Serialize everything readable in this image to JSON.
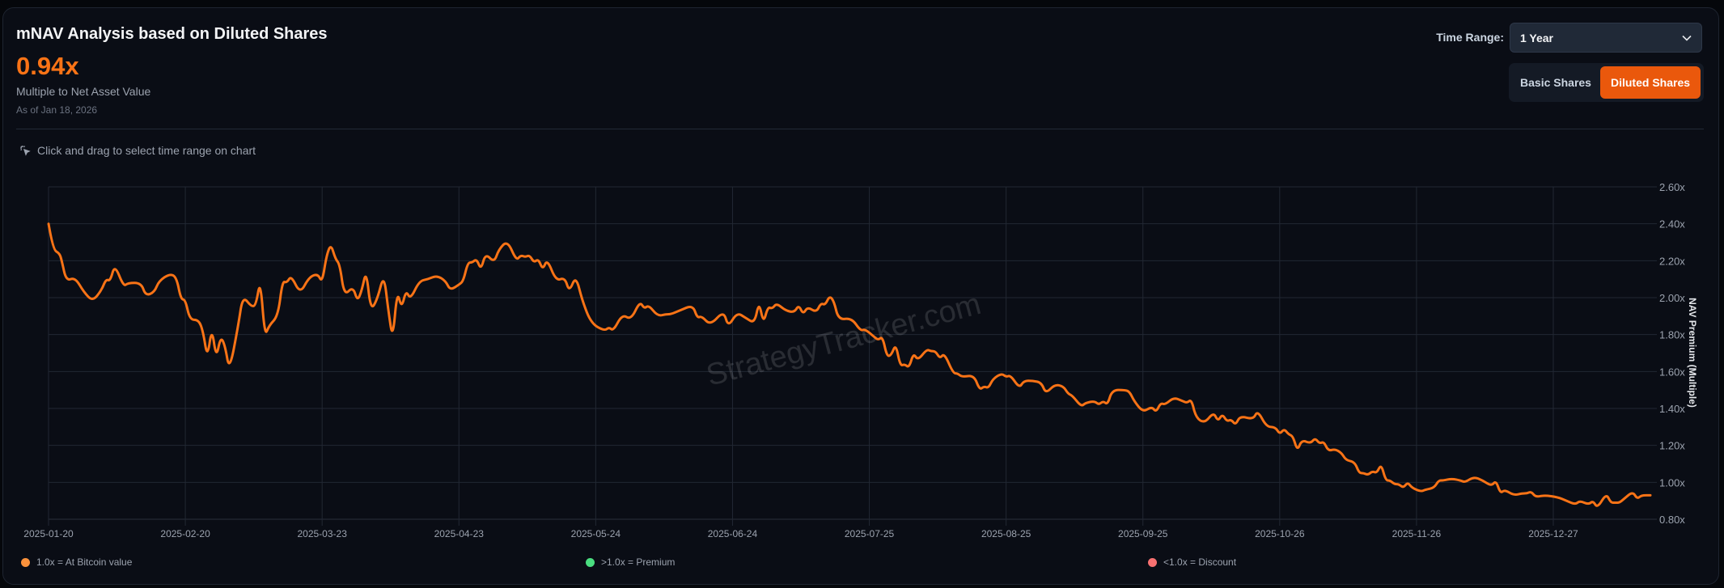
{
  "header": {
    "title": "mNAV Analysis based on Diluted Shares",
    "value": "0.94x",
    "subtitle": "Multiple to Net Asset Value",
    "as_of": "As of Jan 18, 2026",
    "hint": "Click and drag to select time range on chart"
  },
  "controls": {
    "time_range_label": "Time Range:",
    "time_range_value": "1 Year",
    "basic_label": "Basic Shares",
    "diluted_label": "Diluted Shares",
    "active": "Diluted Shares"
  },
  "colors": {
    "accent": "#ea580c",
    "line": "#f97316",
    "at_value": "#fb923c",
    "premium": "#4ade80",
    "discount": "#f87171"
  },
  "legend": [
    {
      "label": "1.0x = At Bitcoin value",
      "color": "#fb923c"
    },
    {
      "label": ">1.0x = Premium",
      "color": "#4ade80"
    },
    {
      "label": "<1.0x = Discount",
      "color": "#f87171"
    }
  ],
  "watermark": "StrategyTracker.com",
  "chart_data": {
    "type": "line",
    "title": "mNAV Analysis based on Diluted Shares",
    "ylabel": "NAV Premium (Multiple)",
    "xlabel": "",
    "x_start": "2025-01-20",
    "x_units": "days since 2025-01-20",
    "xlim": [
      0,
      363
    ],
    "ylim": [
      0.8,
      2.6
    ],
    "y_ticks": [
      "0.80x",
      "1.00x",
      "1.20x",
      "1.40x",
      "1.60x",
      "1.80x",
      "2.00x",
      "2.20x",
      "2.40x",
      "2.60x"
    ],
    "x_ticks": [
      {
        "day": 0,
        "label": "2025-01-20"
      },
      {
        "day": 31,
        "label": "2025-02-20"
      },
      {
        "day": 62,
        "label": "2025-03-23"
      },
      {
        "day": 93,
        "label": "2025-04-23"
      },
      {
        "day": 124,
        "label": "2025-05-24"
      },
      {
        "day": 155,
        "label": "2025-06-24"
      },
      {
        "day": 186,
        "label": "2025-07-25"
      },
      {
        "day": 217,
        "label": "2025-08-25"
      },
      {
        "day": 248,
        "label": "2025-09-25"
      },
      {
        "day": 279,
        "label": "2025-10-26"
      },
      {
        "day": 310,
        "label": "2025-11-26"
      },
      {
        "day": 341,
        "label": "2025-12-27"
      }
    ],
    "grid": true,
    "series": [
      {
        "name": "mNAV",
        "points": [
          [
            0,
            2.4
          ],
          [
            1,
            2.26
          ],
          [
            2.5,
            2.24
          ],
          [
            3,
            2.2
          ],
          [
            4,
            2.09
          ],
          [
            6,
            2.11
          ],
          [
            8,
            2.03
          ],
          [
            10,
            1.98
          ],
          [
            12,
            2.04
          ],
          [
            13,
            2.1
          ],
          [
            14,
            2.09
          ],
          [
            15,
            2.18
          ],
          [
            17,
            2.06
          ],
          [
            18,
            2.08
          ],
          [
            21,
            2.08
          ],
          [
            22,
            2.01
          ],
          [
            24,
            2.03
          ],
          [
            25,
            2.09
          ],
          [
            27.5,
            2.13
          ],
          [
            29,
            2.11
          ],
          [
            30,
            1.99
          ],
          [
            31,
            1.99
          ],
          [
            32,
            1.88
          ],
          [
            34,
            1.88
          ],
          [
            35,
            1.82
          ],
          [
            36,
            1.67
          ],
          [
            37,
            1.84
          ],
          [
            38,
            1.67
          ],
          [
            39,
            1.79
          ],
          [
            40,
            1.74
          ],
          [
            41,
            1.6
          ],
          [
            43,
            1.85
          ],
          [
            44,
            2.01
          ],
          [
            46,
            1.95
          ],
          [
            47,
            1.96
          ],
          [
            48,
            2.1
          ],
          [
            49,
            1.79
          ],
          [
            50,
            1.85
          ],
          [
            52,
            1.9
          ],
          [
            53,
            2.09
          ],
          [
            54,
            2.08
          ],
          [
            55,
            2.12
          ],
          [
            57,
            2.02
          ],
          [
            59,
            2.11
          ],
          [
            61,
            2.13
          ],
          [
            62,
            2.08
          ],
          [
            63,
            2.23
          ],
          [
            64,
            2.29
          ],
          [
            65,
            2.21
          ],
          [
            66,
            2.18
          ],
          [
            67,
            2.01
          ],
          [
            69,
            2.06
          ],
          [
            70,
            1.98
          ],
          [
            71,
            2.04
          ],
          [
            72,
            2.15
          ],
          [
            73,
            1.93
          ],
          [
            74.5,
            1.99
          ],
          [
            76,
            2.13
          ],
          [
            77,
            1.93
          ],
          [
            78,
            1.77
          ],
          [
            79,
            2.04
          ],
          [
            80,
            1.94
          ],
          [
            81,
            2.04
          ],
          [
            82,
            1.99
          ],
          [
            84,
            2.09
          ],
          [
            86,
            2.1
          ],
          [
            88,
            2.12
          ],
          [
            90,
            2.09
          ],
          [
            91,
            2.04
          ],
          [
            93,
            2.07
          ],
          [
            94,
            2.09
          ],
          [
            95,
            2.19
          ],
          [
            96,
            2.19
          ],
          [
            97,
            2.21
          ],
          [
            98,
            2.15
          ],
          [
            99,
            2.24
          ],
          [
            101,
            2.19
          ],
          [
            102,
            2.26
          ],
          [
            104,
            2.31
          ],
          [
            106,
            2.2
          ],
          [
            107,
            2.23
          ],
          [
            108,
            2.22
          ],
          [
            109,
            2.23
          ],
          [
            110,
            2.19
          ],
          [
            111,
            2.21
          ],
          [
            112,
            2.15
          ],
          [
            113,
            2.21
          ],
          [
            115,
            2.09
          ],
          [
            117,
            2.11
          ],
          [
            118,
            2.03
          ],
          [
            119.5,
            2.12
          ],
          [
            121,
            1.98
          ],
          [
            123,
            1.86
          ],
          [
            126,
            1.82
          ],
          [
            127,
            1.84
          ],
          [
            128,
            1.82
          ],
          [
            130,
            1.91
          ],
          [
            132,
            1.88
          ],
          [
            134,
            1.98
          ],
          [
            135,
            1.94
          ],
          [
            136,
            1.96
          ],
          [
            138,
            1.9
          ],
          [
            140,
            1.91
          ],
          [
            141,
            1.91
          ],
          [
            143,
            1.93
          ],
          [
            146,
            1.96
          ],
          [
            147,
            1.89
          ],
          [
            148,
            1.9
          ],
          [
            150,
            1.85
          ],
          [
            153,
            1.93
          ],
          [
            154,
            1.84
          ],
          [
            156,
            1.92
          ],
          [
            158,
            1.89
          ],
          [
            160,
            1.86
          ],
          [
            161,
            1.98
          ],
          [
            162,
            1.86
          ],
          [
            163,
            1.95
          ],
          [
            164,
            1.94
          ],
          [
            165,
            1.97
          ],
          [
            167,
            1.93
          ],
          [
            169,
            1.92
          ],
          [
            170,
            1.96
          ],
          [
            171,
            1.91
          ],
          [
            172,
            1.95
          ],
          [
            174,
            1.92
          ],
          [
            175,
            1.97
          ],
          [
            176,
            1.96
          ],
          [
            177,
            2.01
          ],
          [
            178,
            1.98
          ],
          [
            179,
            1.88
          ],
          [
            182,
            1.89
          ],
          [
            184,
            1.82
          ],
          [
            185,
            1.83
          ],
          [
            187,
            1.79
          ],
          [
            188,
            1.77
          ],
          [
            189,
            1.79
          ],
          [
            190,
            1.68
          ],
          [
            191,
            1.69
          ],
          [
            192,
            1.75
          ],
          [
            193,
            1.63
          ],
          [
            194,
            1.64
          ],
          [
            195,
            1.62
          ],
          [
            196,
            1.7
          ],
          [
            197,
            1.66
          ],
          [
            199,
            1.72
          ],
          [
            200,
            1.71
          ],
          [
            201,
            1.71
          ],
          [
            202,
            1.67
          ],
          [
            203,
            1.7
          ],
          [
            205,
            1.59
          ],
          [
            206,
            1.59
          ],
          [
            207,
            1.57
          ],
          [
            209.7,
            1.58
          ],
          [
            211,
            1.5
          ],
          [
            212,
            1.52
          ],
          [
            213,
            1.51
          ],
          [
            214,
            1.56
          ],
          [
            216,
            1.59
          ],
          [
            217,
            1.57
          ],
          [
            218,
            1.58
          ],
          [
            220,
            1.51
          ],
          [
            221,
            1.55
          ],
          [
            223,
            1.55
          ],
          [
            225,
            1.54
          ],
          [
            226,
            1.48
          ],
          [
            228,
            1.53
          ],
          [
            230,
            1.52
          ],
          [
            231,
            1.48
          ],
          [
            232,
            1.47
          ],
          [
            234,
            1.41
          ],
          [
            235,
            1.43
          ],
          [
            237,
            1.44
          ],
          [
            238,
            1.42
          ],
          [
            239,
            1.44
          ],
          [
            240,
            1.42
          ],
          [
            241,
            1.5
          ],
          [
            244,
            1.5
          ],
          [
            245,
            1.49
          ],
          [
            246,
            1.44
          ],
          [
            248,
            1.38
          ],
          [
            250,
            1.41
          ],
          [
            251,
            1.38
          ],
          [
            252,
            1.43
          ],
          [
            253,
            1.42
          ],
          [
            255,
            1.46
          ],
          [
            257,
            1.44
          ],
          [
            258,
            1.43
          ],
          [
            259,
            1.45
          ],
          [
            260,
            1.35
          ],
          [
            262,
            1.32
          ],
          [
            264,
            1.38
          ],
          [
            265,
            1.33
          ],
          [
            266,
            1.37
          ],
          [
            267,
            1.33
          ],
          [
            268,
            1.34
          ],
          [
            269,
            1.31
          ],
          [
            270,
            1.36
          ],
          [
            273,
            1.34
          ],
          [
            274,
            1.39
          ],
          [
            276,
            1.3
          ],
          [
            278,
            1.3
          ],
          [
            279,
            1.26
          ],
          [
            280,
            1.29
          ],
          [
            281,
            1.26
          ],
          [
            282,
            1.25
          ],
          [
            283,
            1.17
          ],
          [
            284,
            1.23
          ],
          [
            286,
            1.21
          ],
          [
            287,
            1.24
          ],
          [
            288,
            1.21
          ],
          [
            289,
            1.22
          ],
          [
            290,
            1.17
          ],
          [
            291.5,
            1.18
          ],
          [
            293,
            1.16
          ],
          [
            294,
            1.12
          ],
          [
            296,
            1.11
          ],
          [
            297,
            1.05
          ],
          [
            298,
            1.05
          ],
          [
            299,
            1.04
          ],
          [
            300,
            1.06
          ],
          [
            301,
            1.05
          ],
          [
            302,
            1.1
          ],
          [
            303,
            1.01
          ],
          [
            304,
            1.01
          ],
          [
            305,
            0.99
          ],
          [
            306,
            0.99
          ],
          [
            307,
            0.97
          ],
          [
            308,
            1.0
          ],
          [
            309,
            0.97
          ],
          [
            311,
            0.95
          ],
          [
            312,
            0.96
          ],
          [
            314,
            0.97
          ],
          [
            315,
            1.01
          ],
          [
            316,
            1.01
          ],
          [
            318,
            1.02
          ],
          [
            320,
            1.01
          ],
          [
            321,
            1.0
          ],
          [
            323,
            1.03
          ],
          [
            325,
            1.01
          ],
          [
            327,
            0.98
          ],
          [
            328,
            1.01
          ],
          [
            329,
            0.94
          ],
          [
            330,
            0.96
          ],
          [
            332,
            0.93
          ],
          [
            334,
            0.94
          ],
          [
            335,
            0.94
          ],
          [
            336,
            0.95
          ],
          [
            337,
            0.92
          ],
          [
            339,
            0.93
          ],
          [
            342,
            0.92
          ],
          [
            344,
            0.9
          ],
          [
            346,
            0.88
          ],
          [
            347,
            0.9
          ],
          [
            349,
            0.88
          ],
          [
            350,
            0.9
          ],
          [
            351,
            0.86
          ],
          [
            353,
            0.94
          ],
          [
            354,
            0.89
          ],
          [
            355,
            0.89
          ],
          [
            356,
            0.89
          ],
          [
            357,
            0.91
          ],
          [
            359,
            0.95
          ],
          [
            360,
            0.91
          ],
          [
            361,
            0.93
          ],
          [
            363,
            0.93
          ]
        ]
      }
    ]
  }
}
